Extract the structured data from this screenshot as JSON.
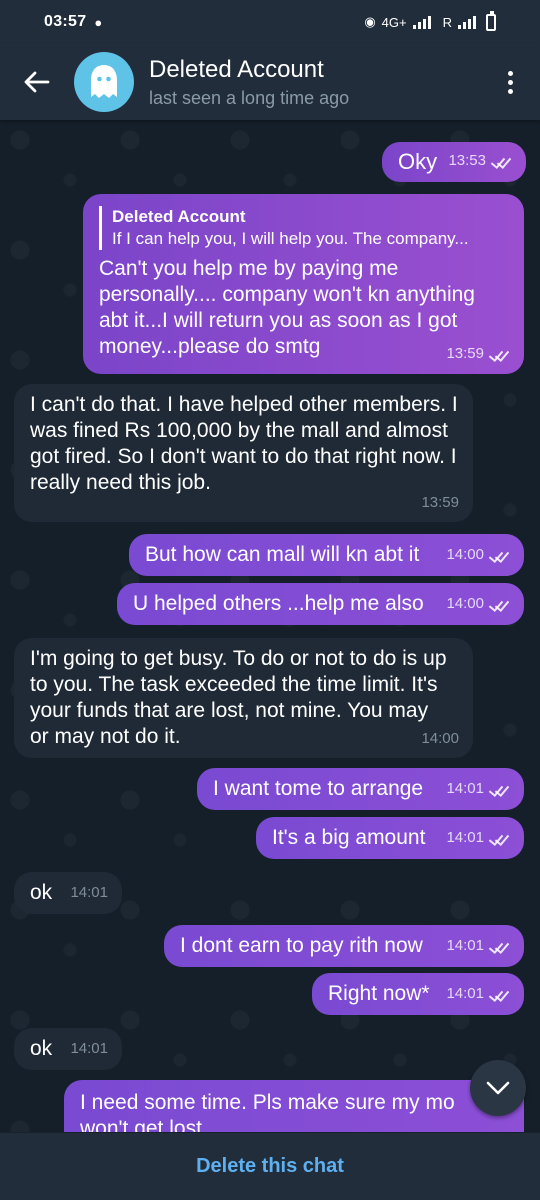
{
  "status_bar": {
    "time": "03:57",
    "network": "4G+",
    "sim2": "R"
  },
  "header": {
    "back_icon": "arrow-left-icon",
    "avatar_icon": "ghost-icon",
    "title": "Deleted Account",
    "subtitle": "last seen a long time ago",
    "menu_icon": "more-vertical-icon"
  },
  "colors": {
    "outgoing_bubble": "#8a4bd0",
    "incoming_bubble": "#1f2a36",
    "accent": "#5fb0f0",
    "avatar": "#5fc3e8"
  },
  "messages": [
    {
      "dir": "out",
      "text": "Oky",
      "time": "13:53",
      "read": true
    },
    {
      "dir": "out",
      "reply_name": "Deleted Account",
      "reply_text": "If I can help you, I will help you. The company...",
      "text": "Can't you help me by paying me personally.... company won't kn anything abt it...I will return you as soon as I got money...please do smtg",
      "time": "13:59",
      "read": true
    },
    {
      "dir": "in",
      "text": "I can't do that. I have helped other members. I was fined Rs 100,000 by the mall and almost got fired. So I don't want to do that right now. I really need this job.",
      "time": "13:59"
    },
    {
      "dir": "out",
      "text": "But how can mall will kn abt it",
      "time": "14:00",
      "read": true
    },
    {
      "dir": "out",
      "text": "U helped others ...help me also",
      "time": "14:00",
      "read": true
    },
    {
      "dir": "in",
      "text": "I'm going to get busy. To do or not to do is up to you. The task exceeded the time limit. It's your funds that are lost, not mine. You may or may not do it.",
      "time": "14:00"
    },
    {
      "dir": "out",
      "text": "I want tome to arrange",
      "time": "14:01",
      "read": true
    },
    {
      "dir": "out",
      "text": "It's a big amount",
      "time": "14:01",
      "read": true
    },
    {
      "dir": "in",
      "text": "ok",
      "time": "14:01"
    },
    {
      "dir": "out",
      "text": "I dont earn to pay rith now",
      "time": "14:01",
      "read": true
    },
    {
      "dir": "out",
      "text": "Right now*",
      "time": "14:01",
      "read": true
    },
    {
      "dir": "in",
      "text": "ok",
      "time": "14:01"
    },
    {
      "dir": "out",
      "text": "I need some time. Pls make sure my mo",
      "text2": "won't get lost",
      "time": "",
      "read": true
    }
  ],
  "scroll_button_icon": "chevron-down-icon",
  "bottom_bar": {
    "action_label": "Delete this chat"
  }
}
